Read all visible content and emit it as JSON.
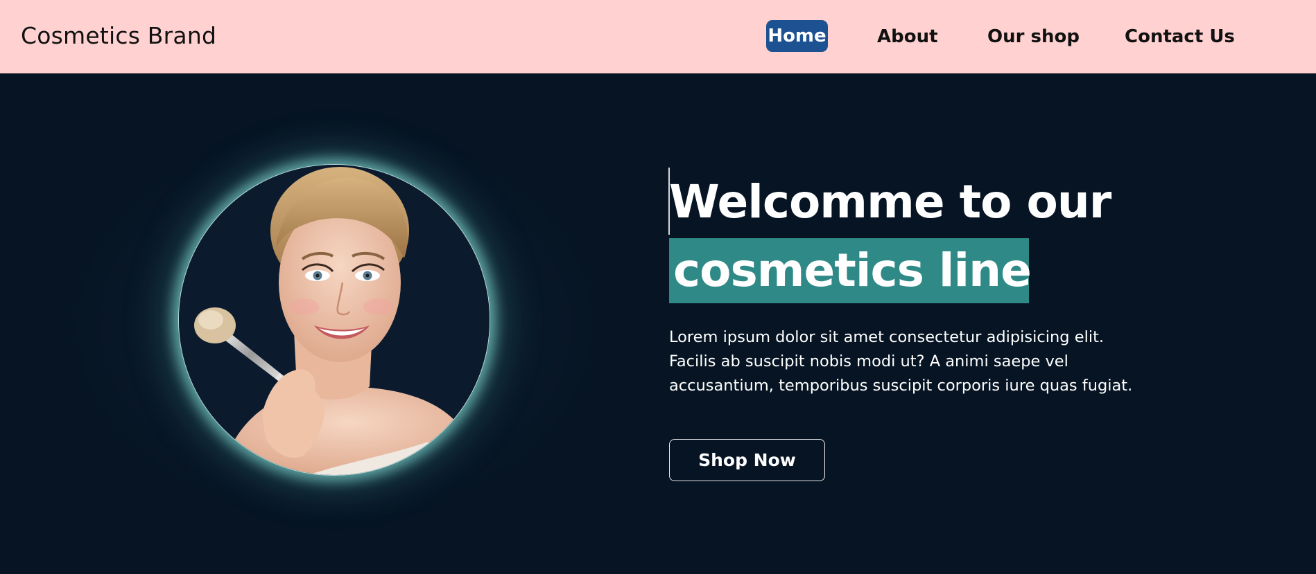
{
  "header": {
    "brand": "Cosmetics Brand",
    "nav": [
      {
        "label": "Home",
        "active": true
      },
      {
        "label": "About",
        "active": false
      },
      {
        "label": "Our shop",
        "active": false
      },
      {
        "label": "Contact Us",
        "active": false
      }
    ]
  },
  "hero": {
    "title_line1": "Welcomme to our",
    "title_line2": "cosmetics line",
    "description": "Lorem ipsum dolor sit amet consectetur adipisicing elit. Facilis ab suscipit nobis modi ut? A animi saepe vel accusantium, temporibus suscipit corporis iure quas fugiat.",
    "cta_label": "Shop Now",
    "image_subject": "smiling woman holding makeup brush"
  },
  "colors": {
    "header_bg": "#ffd1d1",
    "page_bg": "#061423",
    "active_nav": "#1c5192",
    "highlight": "#2f8a87",
    "glow": "#7fcac4"
  }
}
